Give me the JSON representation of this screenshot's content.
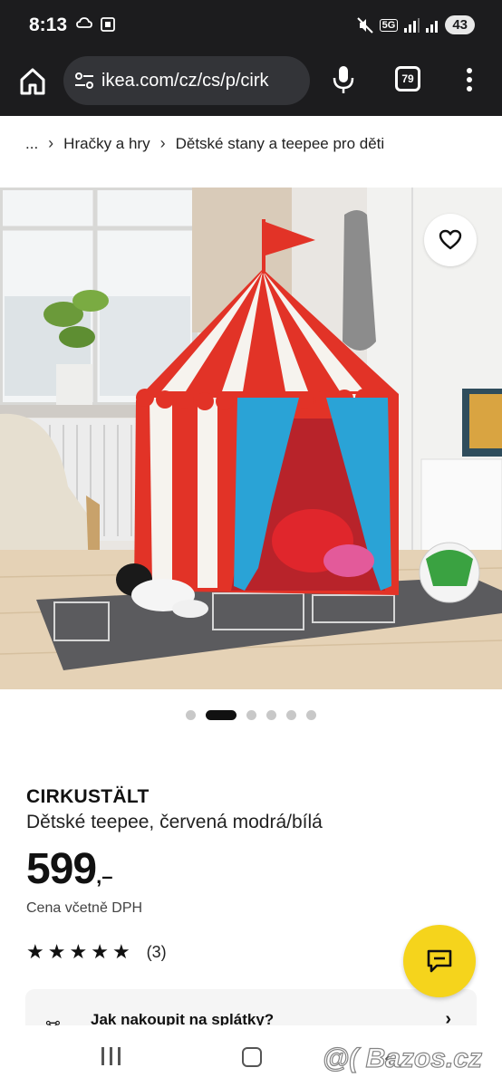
{
  "status_bar": {
    "time": "8:13",
    "battery": "43",
    "network": "5G"
  },
  "browser": {
    "url": "ikea.com/cz/cs/p/cirk",
    "tab_count": "79"
  },
  "breadcrumb": {
    "ellipsis": "...",
    "items": [
      "Hračky a hry",
      "Dětské stany a teepee pro děti"
    ]
  },
  "carousel": {
    "slide_count": 6,
    "active_index": 1
  },
  "product": {
    "name": "CIRKUSTÄLT",
    "description": "Dětské teepee, červená modrá/bílá",
    "price_main": "599",
    "price_suffix": ",–",
    "vat_note": "Cena včetně DPH",
    "rating_stars": 5,
    "review_count": "(3)"
  },
  "installment": {
    "label": "Jak nakoupit na splátky?"
  },
  "watermark": "@( Bazos.cz",
  "colors": {
    "brand_yellow": "#f5d41c",
    "tent_red": "#e23327",
    "tent_blue": "#2aa3d6",
    "dark_bar": "#1c1c1e"
  }
}
